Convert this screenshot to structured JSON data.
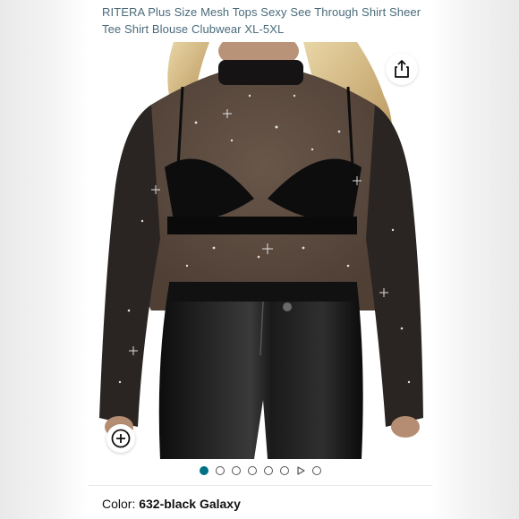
{
  "product": {
    "title": "RITERA Plus Size Mesh Tops Sexy See Through Shirt Sheer Tee Shirt Blouse Clubwear XL-5XL"
  },
  "gallery": {
    "image_count": 8,
    "active_index": 0,
    "video_index": 6,
    "share_icon": "share-icon",
    "zoom_icon": "zoom-in-icon"
  },
  "variant": {
    "label": "Color:",
    "value": "632-black Galaxy"
  },
  "colors": {
    "accent": "#007185",
    "title_text": "#4a6b7a"
  }
}
